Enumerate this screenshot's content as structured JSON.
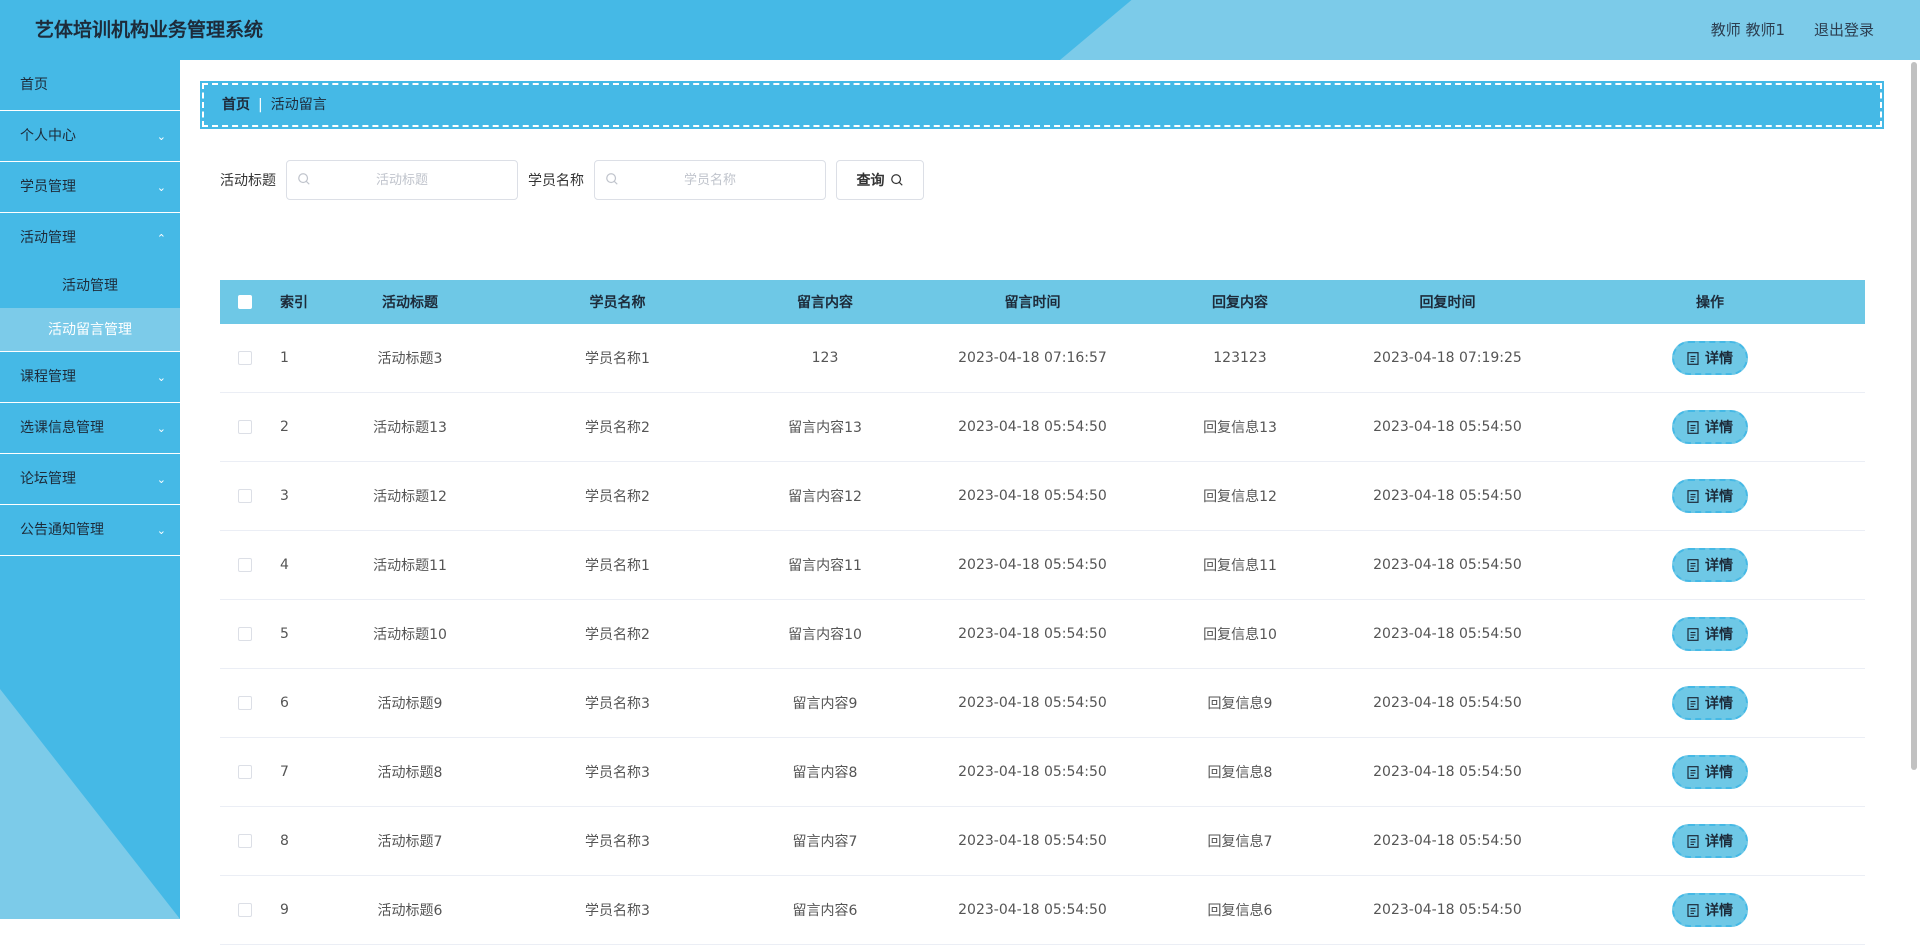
{
  "app": {
    "title": "艺体培训机构业务管理系统",
    "user": "教师 教师1",
    "logout": "退出登录"
  },
  "sidebar": {
    "items": [
      {
        "label": "首页",
        "chevron": false
      },
      {
        "label": "个人中心",
        "chevron": true
      },
      {
        "label": "学员管理",
        "chevron": true
      },
      {
        "label": "活动管理",
        "chevron": true
      },
      {
        "label": "课程管理",
        "chevron": true
      },
      {
        "label": "选课信息管理",
        "chevron": true
      },
      {
        "label": "论坛管理",
        "chevron": true
      },
      {
        "label": "公告通知管理",
        "chevron": true
      }
    ],
    "subitems": [
      {
        "label": "活动管理",
        "active": false
      },
      {
        "label": "活动留言管理",
        "active": true
      }
    ]
  },
  "breadcrumb": {
    "home": "首页",
    "current": "活动留言"
  },
  "search": {
    "title_label": "活动标题",
    "title_placeholder": "活动标题",
    "student_label": "学员名称",
    "student_placeholder": "学员名称",
    "query_button": "查询"
  },
  "table": {
    "columns": [
      "索引",
      "活动标题",
      "学员名称",
      "留言内容",
      "留言时间",
      "回复内容",
      "回复时间",
      "操作"
    ],
    "detail_label": "详情",
    "rows": [
      {
        "index": "1",
        "title": "活动标题3",
        "student": "学员名称1",
        "message": "123",
        "message_time": "2023-04-18 07:16:57",
        "reply": "123123",
        "reply_time": "2023-04-18 07:19:25"
      },
      {
        "index": "2",
        "title": "活动标题13",
        "student": "学员名称2",
        "message": "留言内容13",
        "message_time": "2023-04-18 05:54:50",
        "reply": "回复信息13",
        "reply_time": "2023-04-18 05:54:50"
      },
      {
        "index": "3",
        "title": "活动标题12",
        "student": "学员名称2",
        "message": "留言内容12",
        "message_time": "2023-04-18 05:54:50",
        "reply": "回复信息12",
        "reply_time": "2023-04-18 05:54:50"
      },
      {
        "index": "4",
        "title": "活动标题11",
        "student": "学员名称1",
        "message": "留言内容11",
        "message_time": "2023-04-18 05:54:50",
        "reply": "回复信息11",
        "reply_time": "2023-04-18 05:54:50"
      },
      {
        "index": "5",
        "title": "活动标题10",
        "student": "学员名称2",
        "message": "留言内容10",
        "message_time": "2023-04-18 05:54:50",
        "reply": "回复信息10",
        "reply_time": "2023-04-18 05:54:50"
      },
      {
        "index": "6",
        "title": "活动标题9",
        "student": "学员名称3",
        "message": "留言内容9",
        "message_time": "2023-04-18 05:54:50",
        "reply": "回复信息9",
        "reply_time": "2023-04-18 05:54:50"
      },
      {
        "index": "7",
        "title": "活动标题8",
        "student": "学员名称3",
        "message": "留言内容8",
        "message_time": "2023-04-18 05:54:50",
        "reply": "回复信息8",
        "reply_time": "2023-04-18 05:54:50"
      },
      {
        "index": "8",
        "title": "活动标题7",
        "student": "学员名称3",
        "message": "留言内容7",
        "message_time": "2023-04-18 05:54:50",
        "reply": "回复信息7",
        "reply_time": "2023-04-18 05:54:50"
      },
      {
        "index": "9",
        "title": "活动标题6",
        "student": "学员名称3",
        "message": "留言内容6",
        "message_time": "2023-04-18 05:54:50",
        "reply": "回复信息6",
        "reply_time": "2023-04-18 05:54:50"
      }
    ]
  },
  "colors": {
    "primary": "#45b9e6",
    "light": "#7ccbe9",
    "header_row": "#6ec8e6"
  }
}
